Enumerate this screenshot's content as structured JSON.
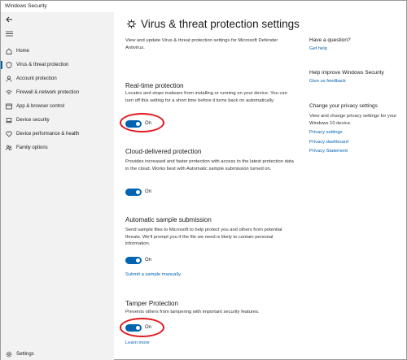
{
  "window": {
    "title": "Windows Security"
  },
  "sidebar": {
    "items": [
      {
        "label": "Home",
        "icon": "home-icon"
      },
      {
        "label": "Virus & threat protection",
        "icon": "shield-icon",
        "active": true
      },
      {
        "label": "Account protection",
        "icon": "person-icon"
      },
      {
        "label": "Firewall & network protection",
        "icon": "wifi-icon"
      },
      {
        "label": "App & browser control",
        "icon": "browser-icon"
      },
      {
        "label": "Device security",
        "icon": "laptop-icon"
      },
      {
        "label": "Device performance & health",
        "icon": "heart-icon"
      },
      {
        "label": "Family options",
        "icon": "family-icon"
      }
    ],
    "settings_label": "Settings"
  },
  "main": {
    "title": "Virus & threat protection settings",
    "description": "View and update Virus & threat protection settings for Microsoft Defender Antivirus.",
    "sections": [
      {
        "title": "Real-time protection",
        "description": "Locates and stops malware from installing or running on your device. You can turn off this setting for a short time before it turns back on automatically.",
        "toggle_label": "On"
      },
      {
        "title": "Cloud-delivered protection",
        "description": "Provides increased and faster protection with access to the latest protection data in the cloud. Works best with Automatic sample submission turned on.",
        "toggle_label": "On"
      },
      {
        "title": "Automatic sample submission",
        "description": "Send sample files to Microsoft to help protect you and others from potential threats. We'll prompt you if the file we need is likely to contain personal information.",
        "toggle_label": "On",
        "link": "Submit a sample manually"
      },
      {
        "title": "Tamper Protection",
        "description": "Prevents others from tampering with important security features.",
        "toggle_label": "On",
        "link": "Learn more"
      }
    ]
  },
  "right": {
    "question_heading": "Have a question?",
    "question_link": "Get help",
    "improve_heading": "Help improve Windows Security",
    "improve_link": "Give us feedback",
    "privacy_heading": "Change your privacy settings",
    "privacy_text": "View and change privacy settings for your Windows 10 device.",
    "privacy_links": [
      "Privacy settings",
      "Privacy dashboard",
      "Privacy Statement"
    ]
  },
  "colors": {
    "accent": "#0063b1",
    "highlight": "#e0171d",
    "sidebar_bg": "#f2f2f2"
  }
}
